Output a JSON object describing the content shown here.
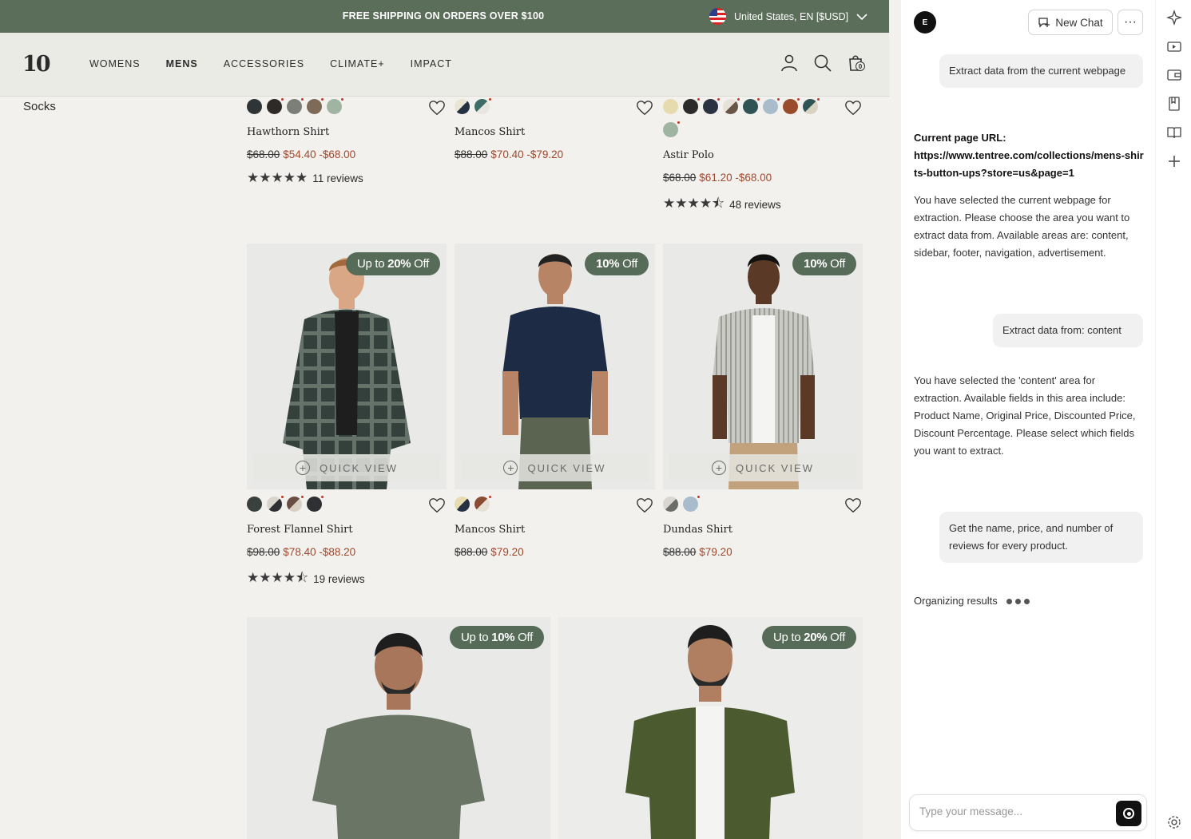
{
  "promo": {
    "text": "FREE SHIPPING ON ORDERS OVER $100",
    "locale": "United States, EN [$USD]"
  },
  "header": {
    "logo": "10",
    "nav": [
      "WOMENS",
      "MENS",
      "ACCESSORIES",
      "CLIMATE+",
      "IMPACT"
    ],
    "active_nav": "MENS",
    "cart_count": "0"
  },
  "sidebar": {
    "item": "Socks"
  },
  "quick_view_label": "QUICK VIEW",
  "products_row1": [
    {
      "name": "Hawthorn Shirt",
      "orig": "$68.00",
      "sale": "$54.40 -$68.00",
      "stars": "★★★★★",
      "reviews": "11 reviews",
      "swatches": [
        "#2f3436",
        "#2e2a28",
        "#7c7f78",
        "#7d6a58",
        "#9fb5a2"
      ]
    },
    {
      "name": "Mancos Shirt",
      "orig": "$88.00",
      "sale": "$70.40 -$79.20",
      "stars": "",
      "reviews": "",
      "swatches": [
        "split:#e9e4d4:#253043",
        "split:#3d6c66:#e8e6df"
      ]
    },
    {
      "name": "Astir Polo",
      "orig": "$68.00",
      "sale": "$61.20 -$68.00",
      "stars": "★★★★⯪",
      "reviews": "48 reviews",
      "swatches": [
        "#e6dbae",
        "#2b2b2b",
        "#2b3342",
        "split:#e7e2d8:#6a5648",
        "#2f5453",
        "#a9bccc",
        "#9a4b2c",
        "split:#2f5453:#d8d2c2",
        "#9fb5a2"
      ]
    }
  ],
  "products_row2": [
    {
      "name": "Forest Flannel Shirt",
      "orig": "$98.00",
      "sale": "$78.40 -$88.20",
      "stars": "★★★★⯪",
      "reviews": "19 reviews",
      "badge_pre": "Up to ",
      "badge_val": "20%",
      "badge_post": " Off",
      "swatches": [
        "#39403e",
        "split:#d9d4cc:#2d2f33",
        "split:#6b4e43:#d8d0c3",
        "#2f3033"
      ]
    },
    {
      "name": "Mancos Shirt",
      "orig": "$88.00",
      "sale": "$79.20",
      "stars": "",
      "reviews": "",
      "badge_pre": "",
      "badge_val": "10%",
      "badge_post": " Off",
      "swatches": [
        "split:#e6dbae:#253043",
        "split:#8a4d34:#e6e0d5"
      ]
    },
    {
      "name": "Dundas Shirt",
      "orig": "$88.00",
      "sale": "$79.20",
      "stars": "",
      "reviews": "",
      "badge_pre": "",
      "badge_val": "10%",
      "badge_post": " Off",
      "swatches": [
        "split:#d8d6d0:#6b6e68",
        "#a9bccc"
      ]
    }
  ],
  "row3_badges": [
    {
      "pre": "Up to ",
      "val": "10%",
      "post": " Off"
    },
    {
      "pre": "Up to ",
      "val": "20%",
      "post": " Off"
    }
  ],
  "assistant": {
    "avatar": "E",
    "new_chat": "New Chat",
    "more": "···",
    "messages": [
      {
        "role": "user",
        "text": "Extract data from the current webpage"
      },
      {
        "role": "bot_url_label",
        "text": "Current page URL:"
      },
      {
        "role": "bot_url",
        "text": "https://www.tentree.com/collections/mens-shirts-button-ups?store=us&page=1"
      },
      {
        "role": "bot",
        "text": "You have selected the current webpage for extraction. Please choose the area you want to extract data from. Available areas are: content, sidebar, footer, navigation, advertisement."
      },
      {
        "role": "user",
        "text": "Extract data from:  content"
      },
      {
        "role": "bot",
        "text": "You have selected the 'content' area for extraction. Available fields in this area include: Product Name, Original Price, Discounted Price, Discount Percentage. Please select which fields you want to extract."
      },
      {
        "role": "user",
        "text": "Get the name, price, and number of reviews for every product."
      },
      {
        "role": "status",
        "text": "Organizing results"
      }
    ],
    "input_placeholder": "Type your message..."
  }
}
